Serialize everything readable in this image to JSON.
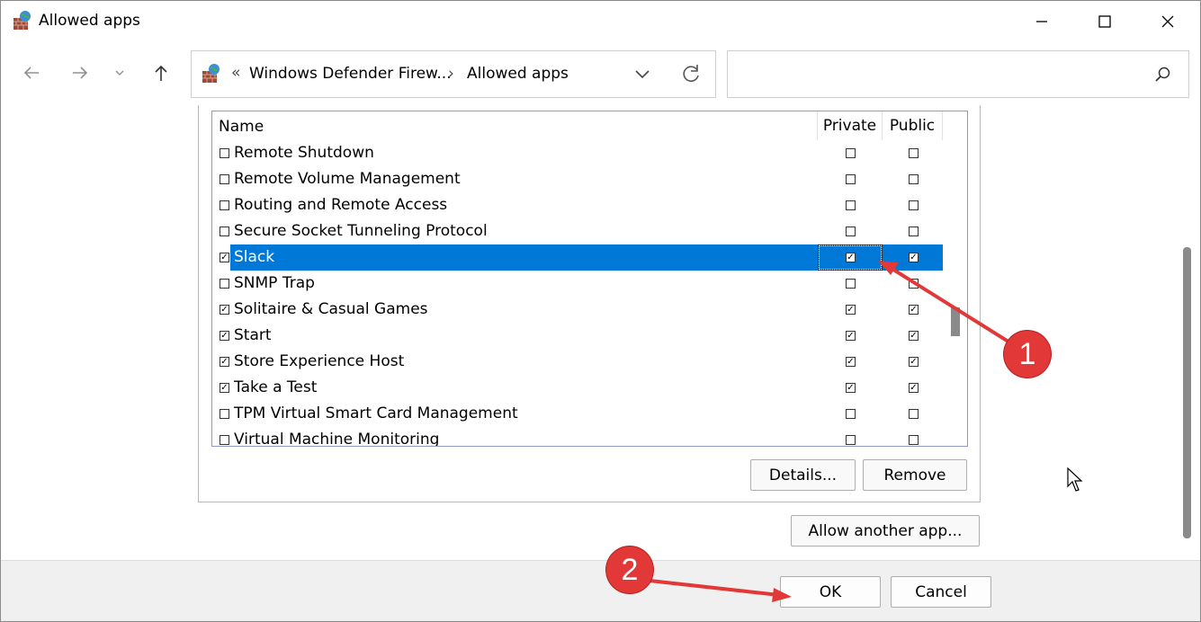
{
  "window": {
    "title": "Allowed apps",
    "minimize_glyph": "—",
    "maximize_glyph": "☐",
    "close_glyph": "✕"
  },
  "nav": {
    "back_glyph": "←",
    "forward_glyph": "→",
    "recent_glyph": "⌄",
    "up_glyph": "↑"
  },
  "address": {
    "overflow_glyph": "«",
    "crumbs": [
      "Windows Defender Firew...",
      "Allowed apps"
    ],
    "separator": "›"
  },
  "search": {
    "placeholder": ""
  },
  "list": {
    "columns": {
      "name": "Name",
      "private": "Private",
      "public": "Public"
    },
    "rows": [
      {
        "label": "Remote Shutdown",
        "enabled": false,
        "private": false,
        "public": false
      },
      {
        "label": "Remote Volume Management",
        "enabled": false,
        "private": false,
        "public": false
      },
      {
        "label": "Routing and Remote Access",
        "enabled": false,
        "private": false,
        "public": false
      },
      {
        "label": "Secure Socket Tunneling Protocol",
        "enabled": false,
        "private": false,
        "public": false
      },
      {
        "label": "Slack",
        "enabled": true,
        "private": true,
        "public": true,
        "selected": true
      },
      {
        "label": "SNMP Trap",
        "enabled": false,
        "private": false,
        "public": false
      },
      {
        "label": "Solitaire & Casual Games",
        "enabled": true,
        "private": true,
        "public": true
      },
      {
        "label": "Start",
        "enabled": true,
        "private": true,
        "public": true
      },
      {
        "label": "Store Experience Host",
        "enabled": true,
        "private": true,
        "public": true
      },
      {
        "label": "Take a Test",
        "enabled": true,
        "private": true,
        "public": true
      },
      {
        "label": "TPM Virtual Smart Card Management",
        "enabled": false,
        "private": false,
        "public": false
      },
      {
        "label": "Virtual Machine Monitoring",
        "enabled": false,
        "private": false,
        "public": false
      }
    ]
  },
  "buttons": {
    "details": "Details...",
    "remove": "Remove",
    "allow_another": "Allow another app...",
    "ok": "OK",
    "cancel": "Cancel"
  },
  "annotations": {
    "badge_1": "1",
    "badge_2": "2",
    "color": "#e23838"
  },
  "colors": {
    "selection": "#0078d7"
  }
}
